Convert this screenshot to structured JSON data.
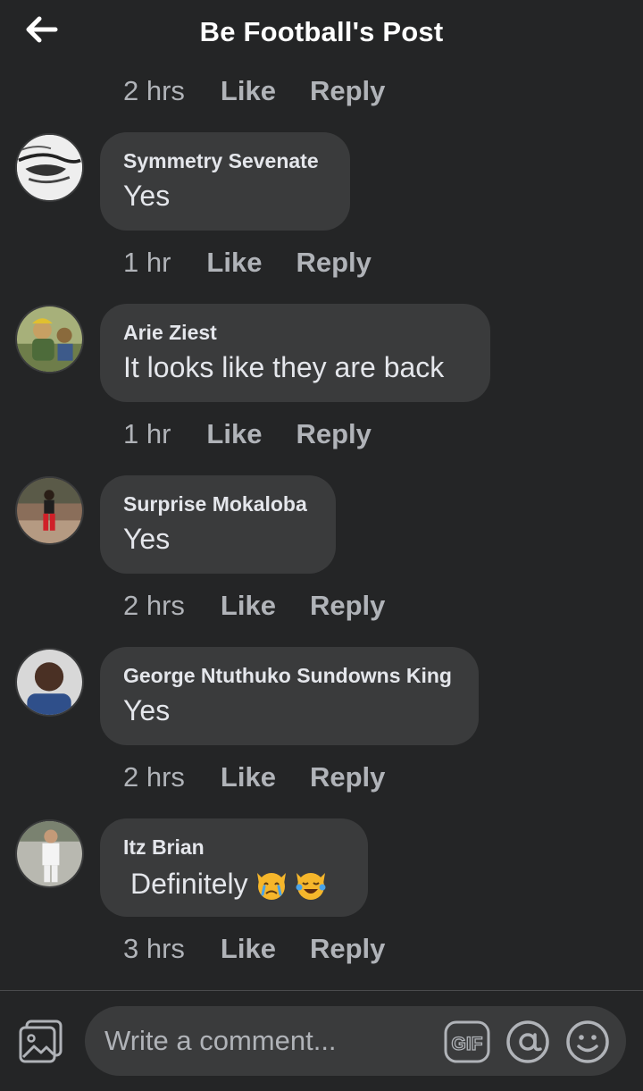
{
  "header": {
    "title": "Be Football's Post"
  },
  "top_meta": {
    "time": "2 hrs",
    "like": "Like",
    "reply": "Reply"
  },
  "comments": [
    {
      "author": "Symmetry Sevenate",
      "text": "Yes",
      "time": "1 hr",
      "like": "Like",
      "reply": "Reply"
    },
    {
      "author": "Arie Ziest",
      "text": "It looks like they are back",
      "time": "1 hr",
      "like": "Like",
      "reply": "Reply"
    },
    {
      "author": "Surprise Mokaloba",
      "text": "Yes",
      "time": "2 hrs",
      "like": "Like",
      "reply": "Reply"
    },
    {
      "author": "George Ntuthuko Sundowns King",
      "text": "Yes",
      "time": "2 hrs",
      "like": "Like",
      "reply": "Reply"
    },
    {
      "author": "Itz Brian",
      "text": "Definitely",
      "emojis": [
        "crying-cat-emoji",
        "joy-cat-emoji"
      ],
      "time": "3 hrs",
      "like": "Like",
      "reply": "Reply"
    }
  ],
  "composer": {
    "placeholder": "Write a comment...",
    "icons": [
      "photo-icon",
      "gif-icon",
      "mention-icon",
      "emoji-icon"
    ]
  },
  "colors": {
    "background": "#242526",
    "bubble": "#3a3b3c",
    "text": "#e4e6eb",
    "muted": "#b0b3b8"
  }
}
